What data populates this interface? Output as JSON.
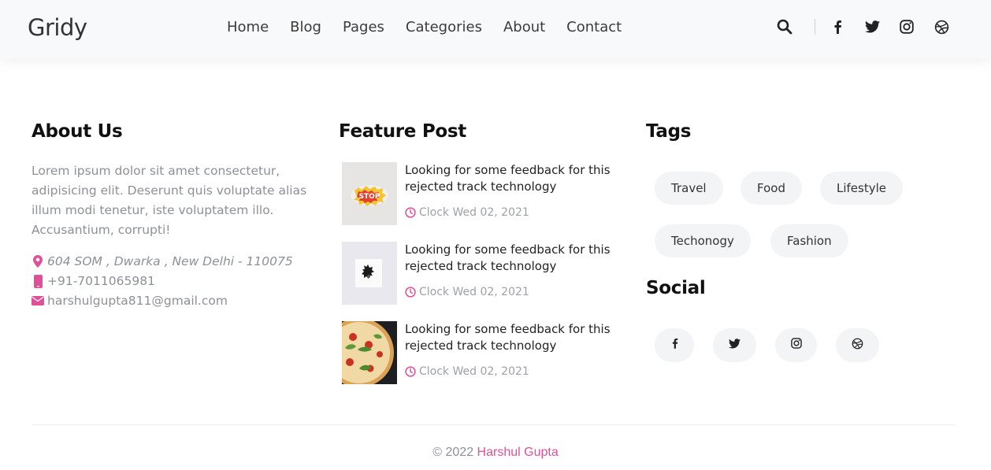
{
  "brand": {
    "logo": "Gridy",
    "accent_color": "#e0509a"
  },
  "nav": {
    "items": [
      {
        "label": "Home"
      },
      {
        "label": "Blog"
      },
      {
        "label": "Pages"
      },
      {
        "label": "Categories"
      },
      {
        "label": "About"
      },
      {
        "label": "Contact"
      }
    ]
  },
  "header_icons": [
    "search-icon",
    "facebook-icon",
    "twitter-icon",
    "instagram-icon",
    "dribbble-icon"
  ],
  "about": {
    "title": "About Us",
    "text": "Lorem ipsum dolor sit amet consectetur, adipisicing elit. Deserunt quis voluptate alias illum modi tenetur, iste voluptatem illo. Accusantium, corrupti!",
    "address": "604 SOM , Dwarka , New Delhi - 110075",
    "phone": "+91-7011065981",
    "email": "harshulgupta811@gmail.com"
  },
  "feature": {
    "title": "Feature Post",
    "posts": [
      {
        "title": "Looking for some feedback for this rejected track technology",
        "meta": "Clock Wed 02, 2021",
        "thumb": "sticker"
      },
      {
        "title": "Looking for some feedback for this rejected track technology",
        "meta": "Clock Wed 02, 2021",
        "thumb": "card"
      },
      {
        "title": "Looking for some feedback for this rejected track technology",
        "meta": "Clock Wed 02, 2021",
        "thumb": "pizza"
      }
    ]
  },
  "tags": {
    "title": "Tags",
    "items": [
      "Travel",
      "Food",
      "Lifestyle",
      "Techonogy",
      "Fashion"
    ]
  },
  "social": {
    "title": "Social",
    "items": [
      "facebook-icon",
      "twitter-icon",
      "instagram-icon",
      "dribbble-icon"
    ]
  },
  "footer": {
    "copyright": "© 2022",
    "author": "Harshul Gupta"
  }
}
